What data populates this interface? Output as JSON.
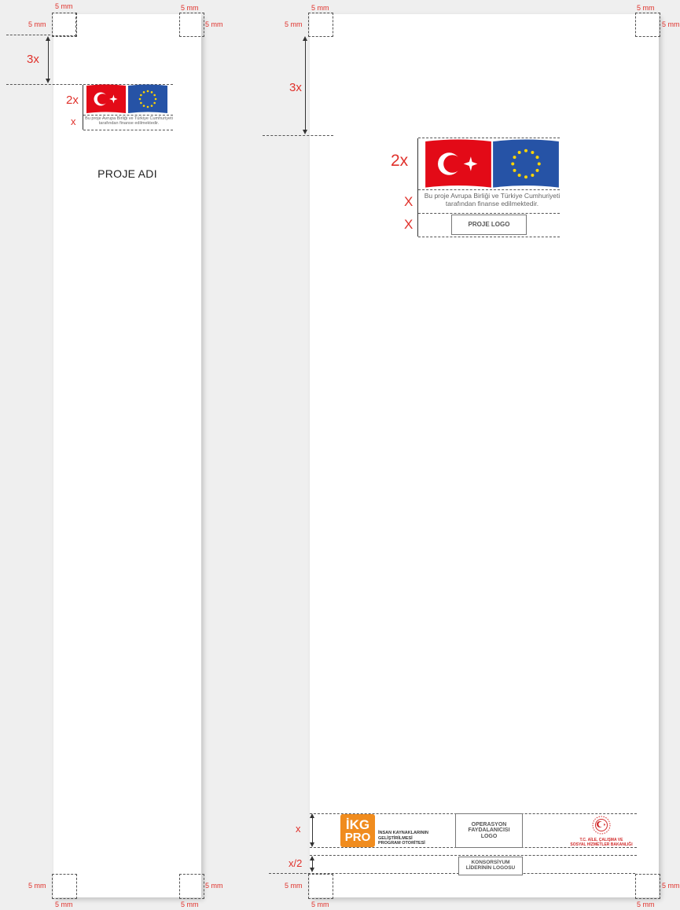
{
  "measurements": {
    "margin": "5 mm",
    "three_x": "3x",
    "two_x_small": "2x",
    "x_small": "x",
    "two_x_large": "2x",
    "x_large_a": "X",
    "x_large_b": "X",
    "x_footer": "x",
    "x_half": "x/2"
  },
  "left_panel": {
    "caption_line1": "Bu proje Avrupa Birliği ve Türkiye Cumhuriyeti",
    "caption_line2": "tarafından finanse edilmektedir.",
    "project_name": "PROJE ADI"
  },
  "right_panel": {
    "caption_line1": "Bu proje Avrupa Birliği ve Türkiye Cumhuriyeti",
    "caption_line2": "tarafından finanse edilmektedir.",
    "project_logo": "PROJE LOGO"
  },
  "footer": {
    "ikg_line1": "İKG",
    "ikg_line2": "PRO",
    "ikg_text_line1": "İNSAN KAYNAKLARININ",
    "ikg_text_line2": "GELİŞTİRİLMESİ",
    "ikg_text_line3": "PROGRAM OTORİTESİ",
    "operasyon_line1": "OPERASYON",
    "operasyon_line2": "FAYDALANICISI",
    "operasyon_line3": "LOGO",
    "konsorsiyum_line1": "KONSORSİYUM",
    "konsorsiyum_line2": "LİDERİNİN LOGOSU",
    "ministry_line1": "T.C. AİLE, ÇALIŞMA VE",
    "ministry_line2": "SOSYAL HİZMETLER BAKANLIĞI"
  },
  "colors": {
    "accent_red": "#e0312b",
    "turkey_red": "#e30a17",
    "eu_blue": "#2653a6",
    "eu_star": "#ffd500",
    "ikg_orange": "#f08c1e"
  }
}
